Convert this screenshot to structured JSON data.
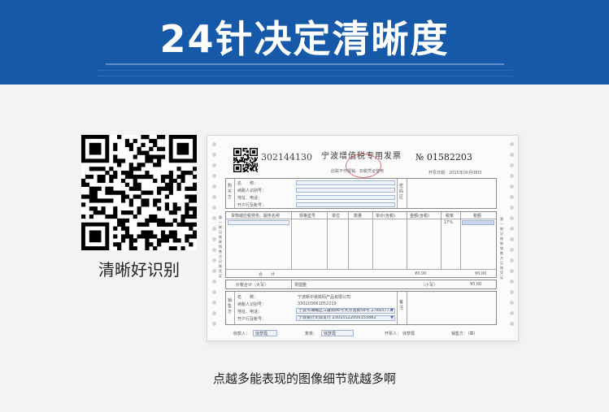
{
  "banner": {
    "title": "24针决定清晰度",
    "accent_color": "#1559a8"
  },
  "qr": {
    "caption": "清晰好识别"
  },
  "invoice": {
    "code": "302144130",
    "title": "宁波增值税专用发票",
    "subtitle": "此联不作报销、扣税凭证使用",
    "number_prefix": "№",
    "number": "01582203",
    "issue_date": "开票日期：2015年06月08日",
    "buyer": {
      "section_label": "购买方",
      "name_label": "名　　称：",
      "tax_label": "纳税人识别号：",
      "address_label": "地址、电话：",
      "bank_label": "开户行及账号："
    },
    "password_area_label": "密码区",
    "items_header": [
      "货物或应税劳务、服务名称",
      "规格型号",
      "单位",
      "数量",
      "单价(含税)",
      "金额(含税)",
      "税率",
      "税额"
    ],
    "tax_rate": "17%",
    "total_label": "合　　计",
    "total_amount": "¥0.00",
    "total_tax": "¥0.00",
    "in_words_label": "价税合计（大写）",
    "in_words_value": "零圆整",
    "lower_case_label": "（小写）",
    "lower_case_value": "¥0.00",
    "seller": {
      "section_label": "销售方",
      "name_label": "名　　称：",
      "name_value": "宁波新中易数码产品有限公司",
      "tax_label": "纳税人识别号：",
      "tax_value": "330203661052219",
      "address_label": "地址、电话：",
      "address_value": "宁波市海曙区江厦街86号大沙泥街58号 27893773",
      "bank_label": "开户行及账号：",
      "bank_value": "宁波银行天源支行 23010122000155882"
    },
    "remarks_label": "备注",
    "payee_label": "收款人：",
    "payee_value": "徐梦霞",
    "reviewer_label": "复核：",
    "reviewer_value": "徐梦霞",
    "drawer_label": "开票人：",
    "drawer_value": "徐梦霞",
    "seller_sign_label": "销售方：（章）",
    "side_label_left": "第一联：记账联　销售方记账凭证",
    "side_label_right": "第一联：记账联　销售方记账凭证"
  },
  "footer": {
    "caption": "点越多能表现的图像细节就越多啊"
  }
}
